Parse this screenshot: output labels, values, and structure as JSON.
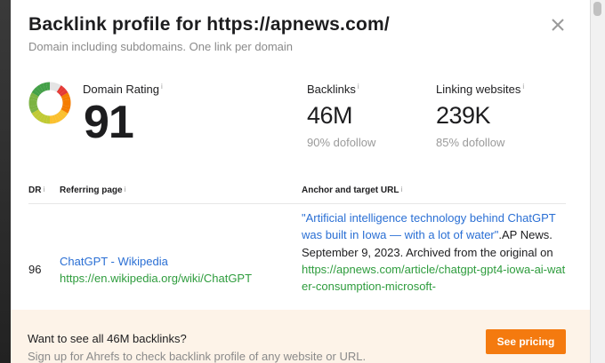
{
  "modal": {
    "title": "Backlink profile for https://apnews.com/",
    "subtitle": "Domain including subdomains. One link per domain",
    "close_icon": "close-icon"
  },
  "metrics": {
    "domain_rating": {
      "label": "Domain Rating",
      "value": "91",
      "value_fraction": 0.91
    },
    "backlinks": {
      "label": "Backlinks",
      "value": "46M",
      "sub": "90% dofollow"
    },
    "linking_websites": {
      "label": "Linking websites",
      "value": "239K",
      "sub": "85% dofollow"
    },
    "info_icon": "i"
  },
  "table": {
    "headers": {
      "dr": "DR",
      "referring_page": "Referring page",
      "anchor": "Anchor and target URL"
    },
    "rows": [
      {
        "dr": "96",
        "ref_title": "ChatGPT - Wikipedia",
        "ref_url": "https://en.wikipedia.org/wiki/ChatGPT",
        "anchor_link": "\"Artificial intelligence technology behind ChatGPT was built in Iowa — with a lot of water\"",
        "anchor_text": ".AP News. September 9, 2023. Archived from the original on",
        "target_url": "https://apnews.com/article/chatgpt-gpt4-iowa-ai-water-consumption-microsoft-"
      }
    ]
  },
  "banner": {
    "title": "Want to see all 46M backlinks?",
    "subtitle": "Sign up for Ahrefs to check backlink profile of any website or URL.",
    "cta_label": "See pricing"
  },
  "colors": {
    "link_blue": "#2a6fd4",
    "url_green": "#2e9c3d",
    "cta_orange": "#f47a0f",
    "banner_bg": "#fdf3e8"
  }
}
